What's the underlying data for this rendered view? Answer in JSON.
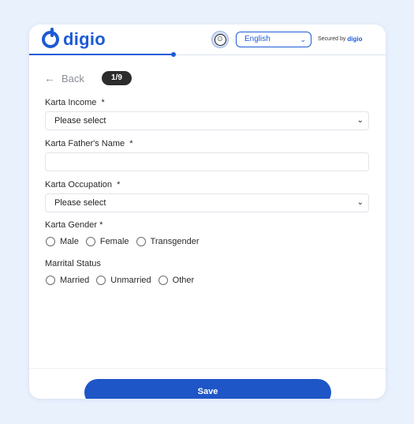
{
  "header": {
    "logo_text": "digio",
    "accessibility_icon": "accessibility-icon",
    "language": {
      "selected": "English"
    },
    "secured_by_label": "Secured by",
    "secured_by_brand": "digio"
  },
  "progress": {
    "fraction": 0.4
  },
  "nav": {
    "back_label": "Back",
    "step_badge": "1/9"
  },
  "form": {
    "karta_income": {
      "label": "Karta Income",
      "required": "*",
      "value": "Please select"
    },
    "karta_father_name": {
      "label": "Karta Father's Name",
      "required": "*",
      "value": ""
    },
    "karta_occupation": {
      "label": "Karta Occupation",
      "required": "*",
      "value": "Please select"
    },
    "karta_gender": {
      "label": "Karta Gender",
      "required": "*",
      "options": [
        "Male",
        "Female",
        "Transgender"
      ]
    },
    "marital_status": {
      "label": "Marrital Status",
      "options": [
        "Married",
        "Unmarried",
        "Other"
      ]
    }
  },
  "footer": {
    "save_label": "Save"
  },
  "colors": {
    "brand": "#1d5bd6",
    "page_bg": "#e9f1fd"
  }
}
